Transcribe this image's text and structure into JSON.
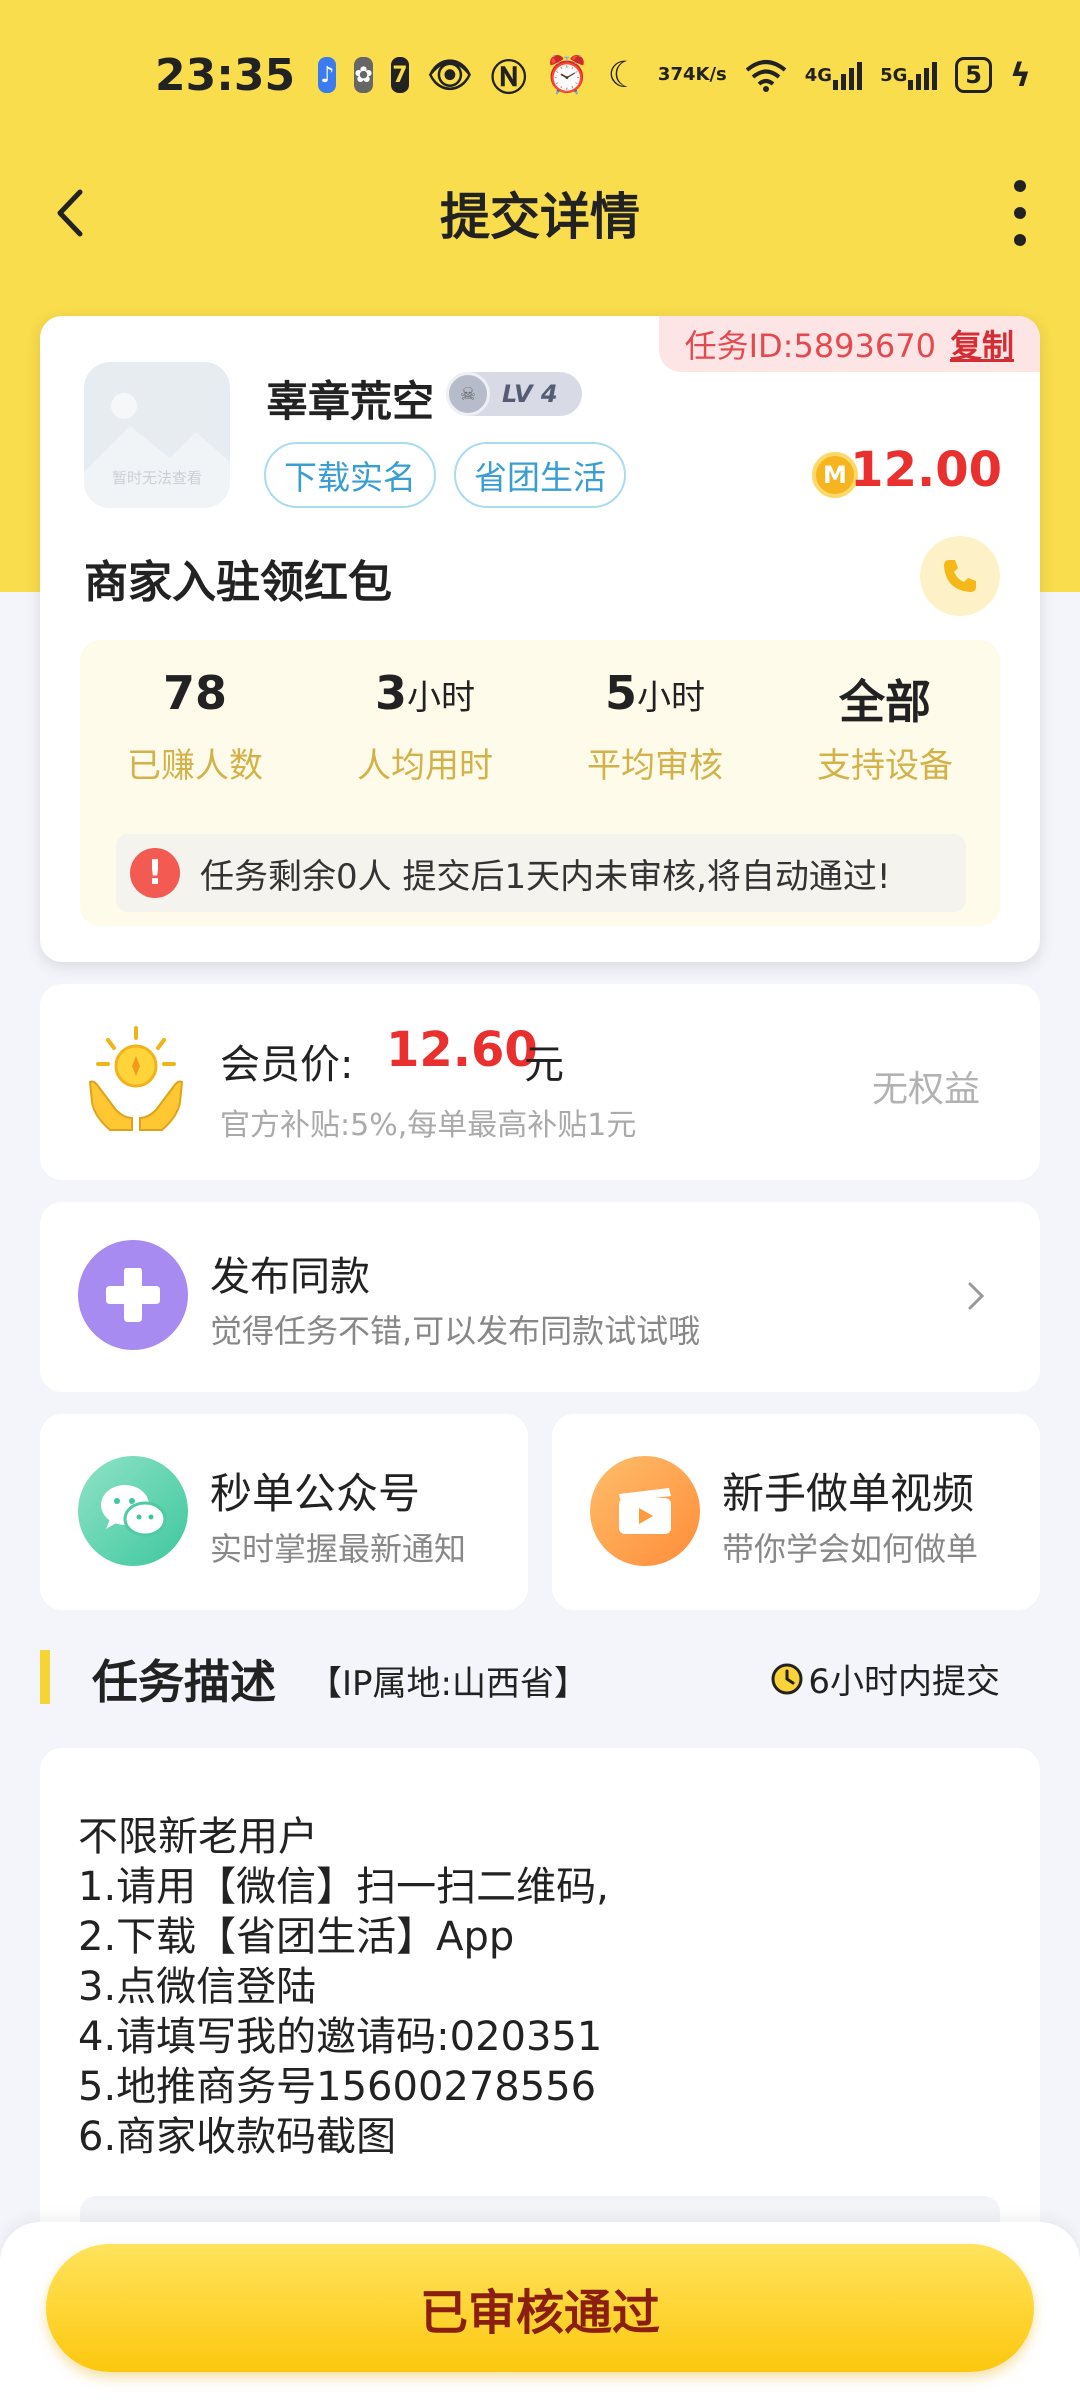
{
  "status_bar": {
    "time": "23:35",
    "net_speed": "374",
    "net_unit": "K/s",
    "sig1": "4G",
    "sig2": "5G",
    "battery": "5"
  },
  "nav": {
    "title": "提交详情"
  },
  "task": {
    "id_text": "任务ID:5893670",
    "copy_label": "复制",
    "thumb_caption": "暂时无法查看",
    "user_name": "辜章荒空",
    "level": "LV 4",
    "tags": [
      "下载实名",
      "省团生活"
    ],
    "reward": "12.00",
    "coin_letter": "M",
    "title": "商家入驻领红包",
    "stats": [
      {
        "value": "78",
        "unit": "",
        "label": "已赚人数"
      },
      {
        "value": "3",
        "unit": "小时",
        "label": "人均用时"
      },
      {
        "value": "5",
        "unit": "小时",
        "label": "平均审核"
      },
      {
        "value": "全部",
        "unit": "",
        "label": "支持设备"
      }
    ],
    "notice": "任务剩余0人  提交后1天内未审核,将自动通过!"
  },
  "member": {
    "label": "会员价:",
    "price": "12.60",
    "unit": "元",
    "sub": "官方补贴:5%,每单最高补贴1元",
    "status": "无权益"
  },
  "publish": {
    "title": "发布同款",
    "sub": "觉得任务不错,可以发布同款试试哦"
  },
  "wechat": {
    "title": "秒单公众号",
    "sub": "实时掌握最新通知"
  },
  "video": {
    "title": "新手做单视频",
    "sub": "带你学会如何做单"
  },
  "description": {
    "title": "任务描述",
    "ip": "【IP属地:山西省】",
    "deadline": "6小时内提交",
    "lines": [
      "不限新老用户",
      "1.请用【微信】扫一扫二维码,",
      "2.下载【省团生活】App",
      "3.点微信登陆",
      "4.请填写我的邀请码:020351",
      "5.地推商务号15600278556",
      "6.商家收款码截图"
    ]
  },
  "bottom": {
    "button": "已审核通过"
  },
  "colors": {
    "brand_yellow": "#fadd4c",
    "price_red": "#ea2f2f",
    "tag_blue": "#3a9ed3",
    "stat_gold": "#d3b24a"
  }
}
